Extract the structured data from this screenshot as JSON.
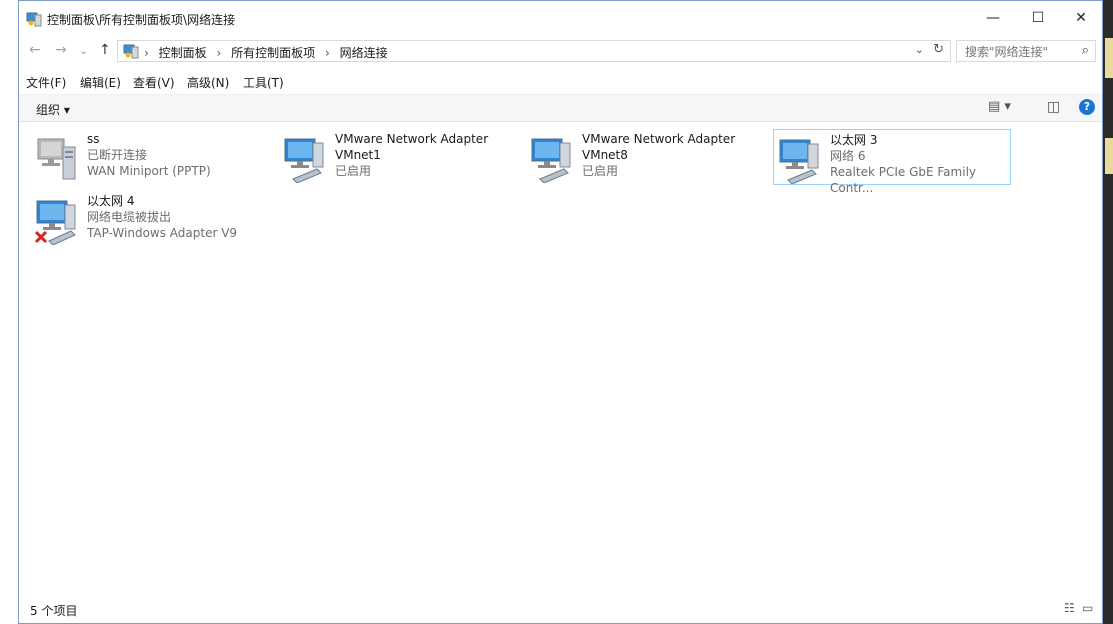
{
  "window": {
    "title": "控制面板\\所有控制面板项\\网络连接",
    "minimize": "—",
    "maximize": "☐",
    "close": "✕"
  },
  "nav": {
    "back": "←",
    "forward": "→",
    "recent": "⌄",
    "up": "↑"
  },
  "address": {
    "crumbs": [
      "控制面板",
      "所有控制面板项",
      "网络连接"
    ],
    "separator": "›",
    "dropdown": "⌄",
    "refresh": "↻"
  },
  "search": {
    "placeholder": "搜索\"网络连接\"",
    "icon": "⌕"
  },
  "menu": {
    "file": "文件(F)",
    "edit": "编辑(E)",
    "view": "查看(V)",
    "advanced": "高级(N)",
    "tools": "工具(T)"
  },
  "command": {
    "organize": "组织 ▾",
    "view_options": "▤ ▾",
    "preview_pane": "◫",
    "help": "?"
  },
  "connections": [
    {
      "name": "ss",
      "status": "已断开连接",
      "device": "WAN Miniport (PPTP)",
      "kind": "vpn"
    },
    {
      "name": "VMware Network Adapter",
      "status": "VMnet1",
      "device": "已启用",
      "kind": "ethernet"
    },
    {
      "name": "VMware Network Adapter",
      "status": "VMnet8",
      "device": "已启用",
      "kind": "ethernet"
    },
    {
      "name": "以太网 3",
      "status": "网络 6",
      "device": "Realtek PCIe GbE Family Contr...",
      "kind": "ethernet"
    },
    {
      "name": "以太网 4",
      "status": "网络电缆被拔出",
      "device": "TAP-Windows Adapter V9",
      "kind": "unplugged"
    }
  ],
  "status": {
    "count": "5 个项目",
    "details_view": "☷",
    "icons_view": "▭"
  },
  "colors": {
    "selection_border": "#99d1ff",
    "help_blue": "#1a74d4",
    "monitor_blue": "#2a86d9",
    "error_red": "#d8261b"
  }
}
